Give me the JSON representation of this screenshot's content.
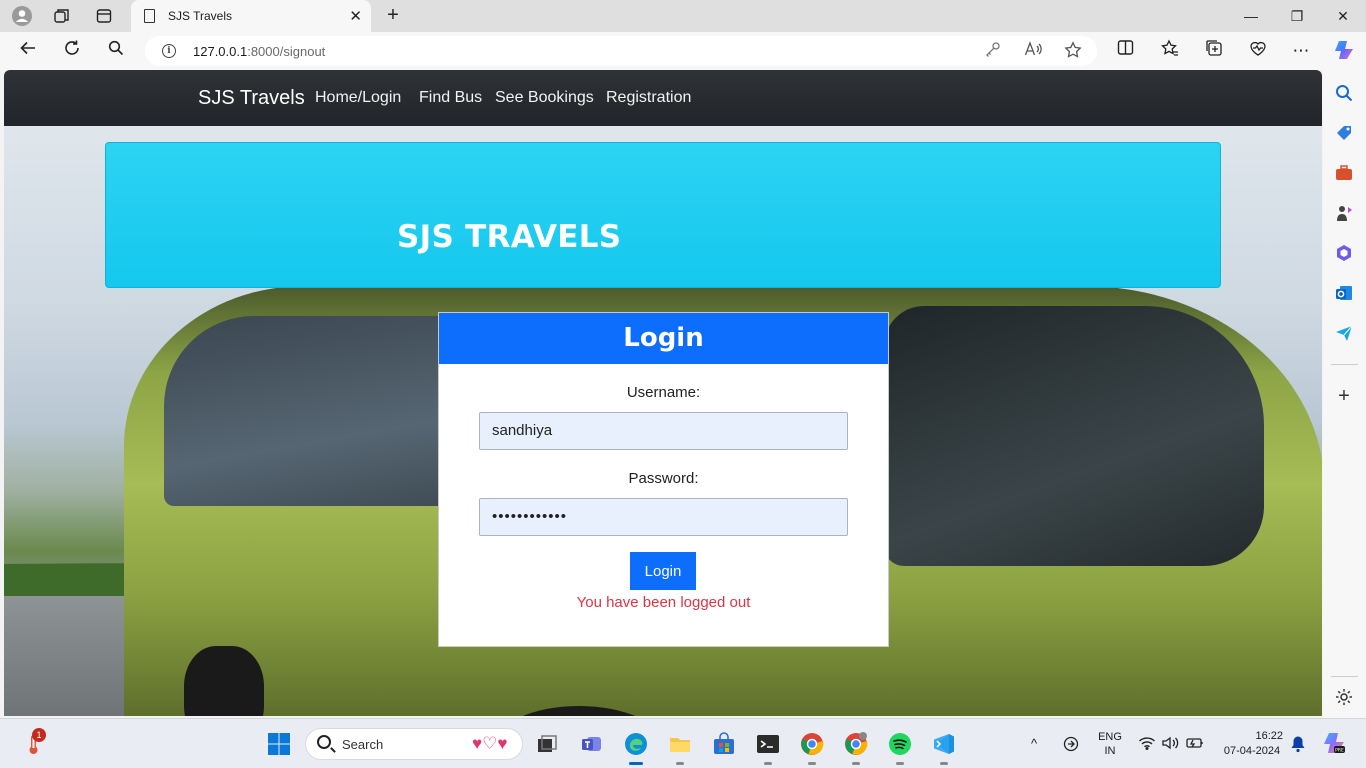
{
  "browser": {
    "tab_title": "SJS Travels",
    "tab_close": "✕",
    "new_tab": "+",
    "url_host": "127.0.0.1",
    "url_rest": ":8000/signout",
    "window_controls": {
      "minimize": "—",
      "maximize": "❐",
      "close": "✕"
    }
  },
  "site": {
    "brand": "SJS Travels",
    "nav": [
      "Home/Login",
      "Find Bus",
      "See Bookings",
      "Registration"
    ],
    "jumbotron_title": "SJS TRAVELS"
  },
  "login": {
    "heading": "Login",
    "username_label": "Username:",
    "username_value": "sandhiya",
    "password_label": "Password:",
    "password_value": "••••••••••••",
    "button": "Login",
    "message": "You have been logged out"
  },
  "taskbar": {
    "search_label": "Search",
    "weather_badge": "1",
    "lang_top": "ENG",
    "lang_bottom": "IN",
    "time": "16:22",
    "date": "07-04-2024"
  },
  "colors": {
    "navbar": "#212529",
    "jumbotron": "#1ccbef",
    "primary": "#0d6efd",
    "danger": "#dc3545"
  }
}
